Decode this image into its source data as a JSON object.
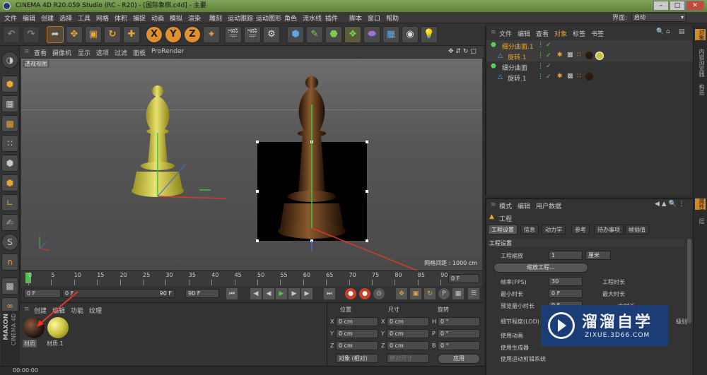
{
  "title": "CINEMA 4D R20.059 Studio (RC - R20) - [国际象棋.c4d] - 主要",
  "menus": [
    "文件",
    "编辑",
    "创建",
    "选择",
    "工具",
    "网格",
    "体积",
    "捕捉",
    "动画",
    "模拟",
    "渲染",
    "雕刻",
    "运动跟踪",
    "运动图形",
    "角色",
    "流水线",
    "插件",
    "脚本",
    "窗口",
    "帮助"
  ],
  "interface_label": "界面:",
  "interface_value": "启动",
  "axis_buttons": [
    "X",
    "Y",
    "Z"
  ],
  "viewport": {
    "menus": [
      "查看",
      "摄像机",
      "显示",
      "选项",
      "过滤",
      "面板",
      "ProRender"
    ],
    "label": "透视视图",
    "grid": "网格间距 : 1000 cm"
  },
  "timeline": {
    "ticks": [
      "0",
      "5",
      "10",
      "15",
      "20",
      "25",
      "30",
      "35",
      "40",
      "45",
      "50",
      "55",
      "60",
      "65",
      "70",
      "75",
      "80",
      "85",
      "90"
    ],
    "end": "0 F"
  },
  "playback": {
    "start": "0 F",
    "current": "0 F",
    "range_end": "90 F",
    "end": "90 F"
  },
  "materials": {
    "menus": [
      "创建",
      "编辑",
      "功能",
      "纹理"
    ],
    "items": [
      "材质",
      "材质.1"
    ],
    "colors": [
      "#2a1a12",
      "#c9c33a"
    ]
  },
  "coords": {
    "headers": [
      "位置",
      "尺寸",
      "旋转"
    ],
    "rows": [
      {
        "a": "X",
        "pos": "0 cm",
        "sa": "X",
        "size": "0 cm",
        "ra": "H",
        "rot": "0 °"
      },
      {
        "a": "Y",
        "pos": "0 cm",
        "sa": "Y",
        "size": "0 cm",
        "ra": "P",
        "rot": "0 °"
      },
      {
        "a": "Z",
        "pos": "0 cm",
        "sa": "Z",
        "size": "0 cm",
        "ra": "B",
        "rot": "0 °"
      }
    ],
    "mode": "对象 (相对)",
    "size_mode": "绝对尺寸",
    "apply": "应用"
  },
  "status": "00:00:00",
  "objects": {
    "menus": [
      "文件",
      "编辑",
      "查看",
      "对象",
      "标签",
      "书签"
    ],
    "items": [
      {
        "name": "细分曲面.1",
        "child": false,
        "highlight": true
      },
      {
        "name": "旋转.1",
        "child": true,
        "highlight": true
      },
      {
        "name": "细分曲面",
        "child": false,
        "highlight": false
      },
      {
        "name": "旋转.1",
        "child": true,
        "highlight": false
      }
    ]
  },
  "attributes": {
    "menus": [
      "模式",
      "编辑",
      "用户数据"
    ],
    "title": "工程",
    "tabs": [
      "工程设置",
      "信息",
      "动力学",
      "参考",
      "待办事项",
      "帧插值"
    ],
    "section": "工程设置",
    "fields": {
      "scale_label": "工程缩放",
      "scale_value": "1",
      "scale_unit": "厘米",
      "scale_btn": "缩放工程...",
      "fps_label": "帧率(FPS)",
      "fps_value": "30",
      "mintime_label": "最小时长",
      "mintime_value": "0 F",
      "preview_label": "预览最小时长",
      "preview_value": "0 F",
      "time_label": "工程时长",
      "maxtime_label": "最大时长",
      "maxtime_short": "大时长",
      "lod_label": "细节程度(LOD)",
      "lod_short": "级别",
      "anim_label": "使用动画",
      "gen_label": "使用生成器",
      "motion_label": "使用运动剪辑系统"
    }
  },
  "right_tabs": [
    "对象",
    "内容浏览器",
    "构造",
    "属性",
    "层"
  ],
  "watermark": {
    "title": "溜溜自学",
    "url": "ZIXUE.3D66.COM"
  },
  "brand": [
    "MAXON",
    "CINEMA 4D"
  ]
}
